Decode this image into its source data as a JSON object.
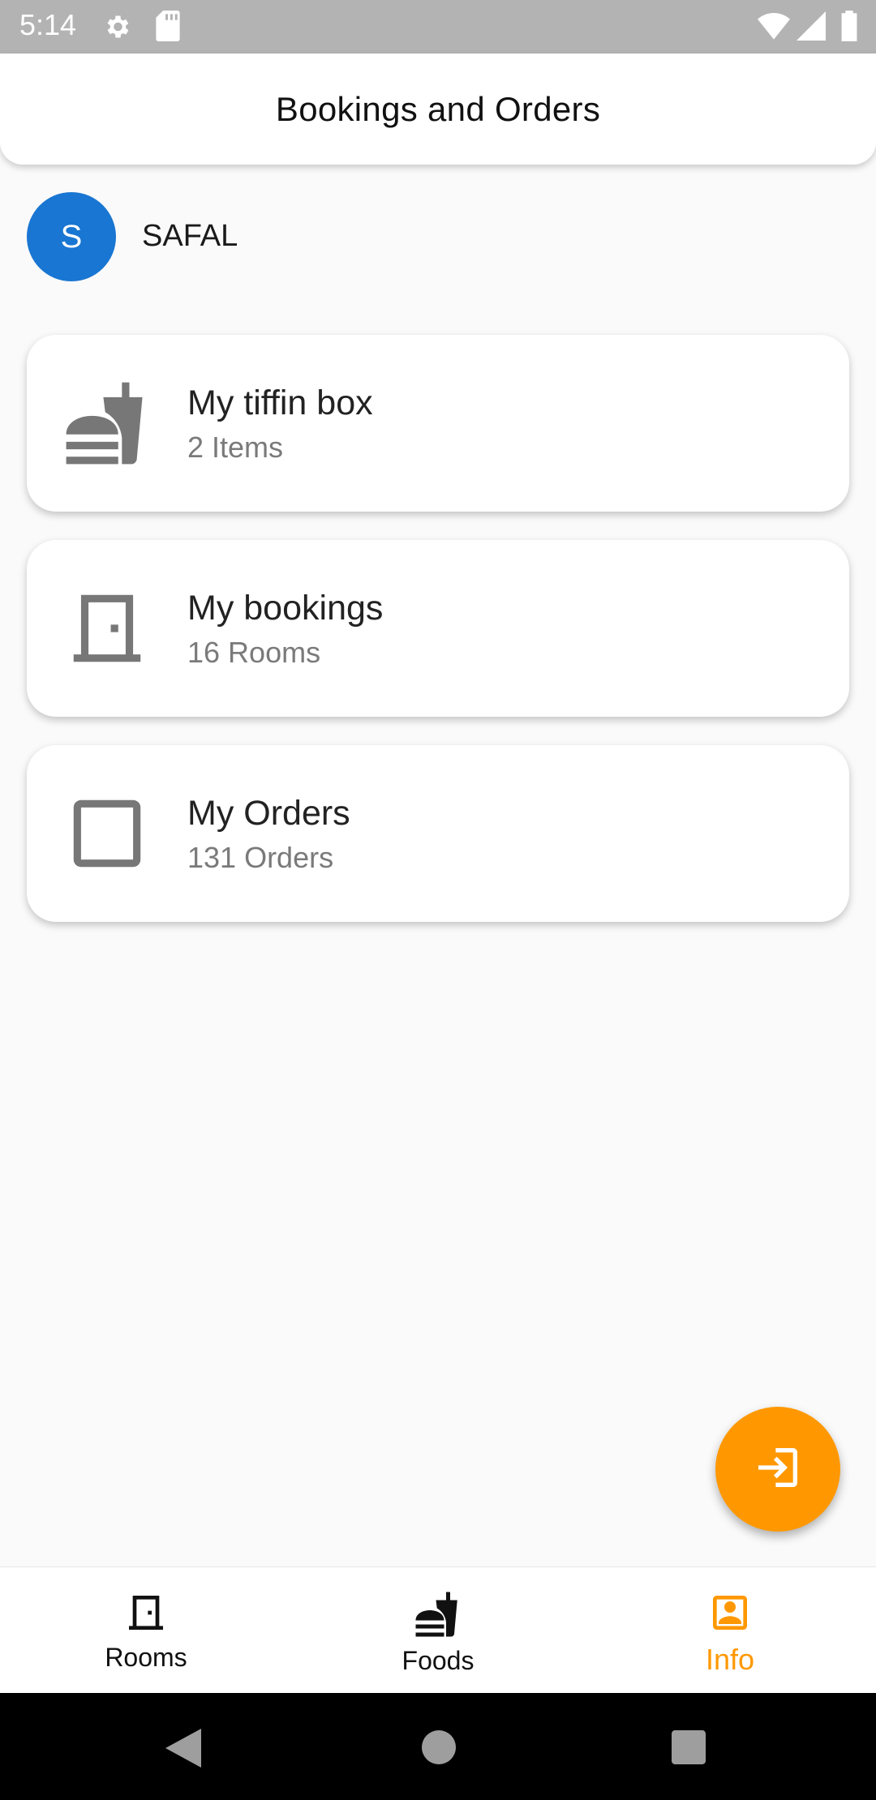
{
  "status_bar": {
    "time": "5:14",
    "icons": [
      "gear-icon",
      "sd-card-icon",
      "wifi-icon",
      "signal-icon",
      "battery-icon"
    ]
  },
  "app_bar": {
    "title": "Bookings and Orders"
  },
  "user": {
    "avatar_letter": "S",
    "name": "SAFAL",
    "avatar_color": "#1976d2"
  },
  "cards": [
    {
      "icon": "fastfood-icon",
      "title": "My tiffin box",
      "subtitle": "2 Items"
    },
    {
      "icon": "door-icon",
      "title": "My bookings",
      "subtitle": "16 Rooms"
    },
    {
      "icon": "checkbox-outline-icon",
      "title": "My Orders",
      "subtitle": "131 Orders"
    }
  ],
  "fab": {
    "icon": "login-icon",
    "color": "#ff9800"
  },
  "bottom_nav": {
    "items": [
      {
        "label": "Rooms",
        "icon": "door-icon",
        "active": false
      },
      {
        "label": "Foods",
        "icon": "fastfood-icon",
        "active": false
      },
      {
        "label": "Info",
        "icon": "account-box-icon",
        "active": true
      }
    ],
    "active_color": "#ff9800"
  },
  "system_nav": {
    "icons": [
      "back-icon",
      "home-icon",
      "recents-icon"
    ]
  }
}
